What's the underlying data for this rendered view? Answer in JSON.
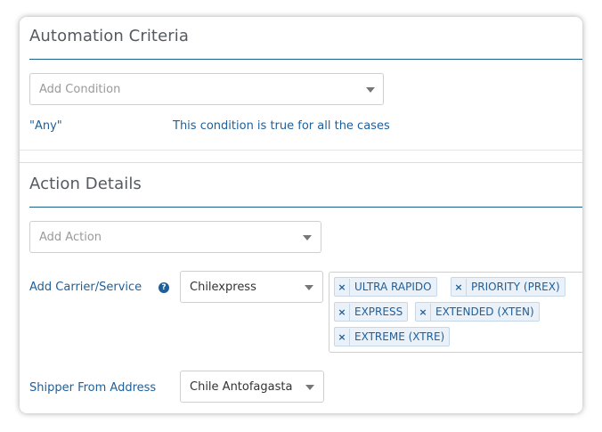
{
  "automation": {
    "title": "Automation Criteria",
    "condition_placeholder": "Add Condition",
    "rule_key": "\"Any\"",
    "rule_desc": "This condition is true for all the cases"
  },
  "action": {
    "title": "Action Details",
    "action_placeholder": "Add Action",
    "carrier_label": "Add Carrier/Service",
    "carrier_value": "Chilexpress",
    "services": [
      "ULTRA RAPIDO",
      "PRIORITY (PREX)",
      "EXPRESS",
      "EXTENDED (XTEN)",
      "EXTREME (XTRE)"
    ],
    "remove_glyph": "×",
    "help_glyph": "?",
    "shipper_label": "Shipper From Address",
    "shipper_value": "Chile Antofagasta"
  },
  "colors": {
    "accent": "#1f5f99",
    "divider": "#1a5f8a"
  }
}
